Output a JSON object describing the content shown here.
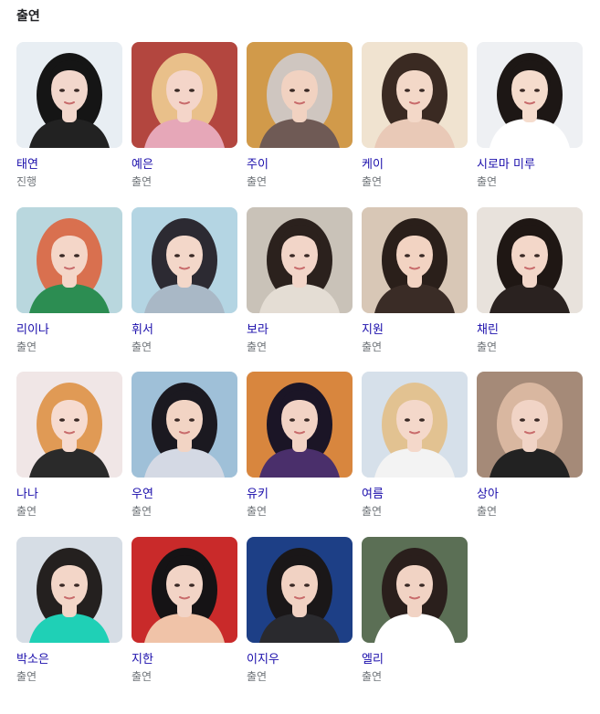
{
  "section": {
    "title": "출연"
  },
  "cast": [
    {
      "name": "태연",
      "role": "진행",
      "portrait": "portrait-image",
      "bg": "#e8eef3",
      "hair": "#151515",
      "skin": "#f2d7cc",
      "top": "#222222"
    },
    {
      "name": "예은",
      "role": "출연",
      "portrait": "portrait-image",
      "bg": "#b3463f",
      "hair": "#e9c08a",
      "skin": "#f4d5c9",
      "top": "#e6a7b8"
    },
    {
      "name": "주이",
      "role": "출연",
      "portrait": "portrait-image",
      "bg": "#d19a4a",
      "hair": "#cfc6c0",
      "skin": "#f1d2c1",
      "top": "#6f5a55"
    },
    {
      "name": "케이",
      "role": "출연",
      "portrait": "portrait-image",
      "bg": "#f0e3d0",
      "hair": "#3a2a22",
      "skin": "#f3d8c8",
      "top": "#e9c9b7"
    },
    {
      "name": "시로마 미루",
      "role": "출연",
      "portrait": "portrait-image",
      "bg": "#eef0f3",
      "hair": "#1d1715",
      "skin": "#f5dccd",
      "top": "#ffffff"
    },
    {
      "name": "리이나",
      "role": "출연",
      "portrait": "portrait-image",
      "bg": "#b9d7de",
      "hair": "#d9704f",
      "skin": "#f4d6c8",
      "top": "#2c8d52"
    },
    {
      "name": "휘서",
      "role": "출연",
      "portrait": "portrait-image",
      "bg": "#b4d5e3",
      "hair": "#2c2a32",
      "skin": "#f3d7c9",
      "top": "#a9b8c6"
    },
    {
      "name": "보라",
      "role": "출연",
      "portrait": "portrait-image",
      "bg": "#c9c2b8",
      "hair": "#2b211d",
      "skin": "#f2d5c8",
      "top": "#e4ddd4"
    },
    {
      "name": "지원",
      "role": "출연",
      "portrait": "portrait-image",
      "bg": "#d8c7b6",
      "hair": "#2a1f1a",
      "skin": "#f2d3c2",
      "top": "#3a2c26"
    },
    {
      "name": "채린",
      "role": "출연",
      "portrait": "portrait-image",
      "bg": "#e8e2dc",
      "hair": "#1f1714",
      "skin": "#f3d7c9",
      "top": "#2a2220"
    },
    {
      "name": "나나",
      "role": "출연",
      "portrait": "portrait-image",
      "bg": "#f0e6e6",
      "hair": "#e09a55",
      "skin": "#f6dbd0",
      "top": "#2a2a2a"
    },
    {
      "name": "우연",
      "role": "출연",
      "portrait": "portrait-image",
      "bg": "#9fc0d8",
      "hair": "#1b1920",
      "skin": "#f2d4c4",
      "top": "#d4d9e4"
    },
    {
      "name": "유키",
      "role": "출연",
      "portrait": "portrait-image",
      "bg": "#d8863e",
      "hair": "#1b1526",
      "skin": "#f2d3c5",
      "top": "#4a2f6b"
    },
    {
      "name": "여름",
      "role": "출연",
      "portrait": "portrait-image",
      "bg": "#d6e0ea",
      "hair": "#e2c291",
      "skin": "#f4d8ca",
      "top": "#f3f3f3"
    },
    {
      "name": "상아",
      "role": "출연",
      "portrait": "portrait-image",
      "bg": "#a58a78",
      "hair": "#d9b7a0",
      "skin": "#f1d4c6",
      "top": "#222222"
    },
    {
      "name": "박소은",
      "role": "출연",
      "portrait": "portrait-image",
      "bg": "#d6dde5",
      "hair": "#24201f",
      "skin": "#f3d6c8",
      "top": "#1fd0b6"
    },
    {
      "name": "지한",
      "role": "출연",
      "portrait": "portrait-image",
      "bg": "#c92a2a",
      "hair": "#151315",
      "skin": "#f2d4c6",
      "top": "#f0c3a8"
    },
    {
      "name": "이지우",
      "role": "출연",
      "portrait": "portrait-image",
      "bg": "#1d3f86",
      "hair": "#1a1718",
      "skin": "#f1d2c3",
      "top": "#2a2a2e"
    },
    {
      "name": "엘리",
      "role": "출연",
      "portrait": "portrait-image",
      "bg": "#5b6f55",
      "hair": "#2a1f1c",
      "skin": "#f1d3c4",
      "top": "#ffffff"
    }
  ]
}
